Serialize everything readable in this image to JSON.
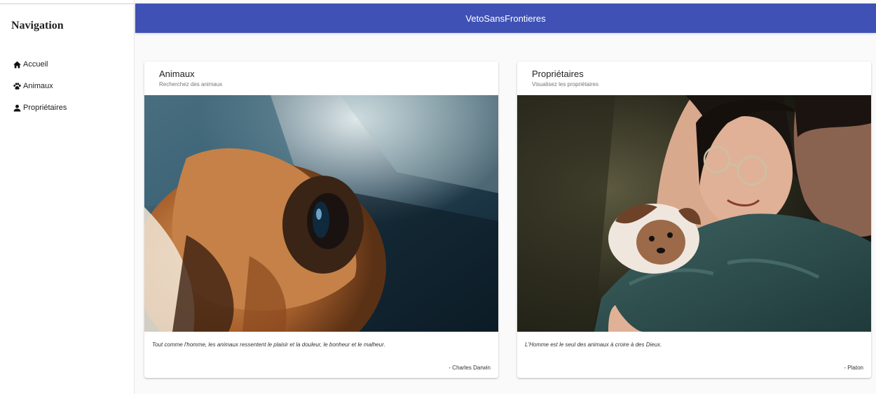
{
  "app": {
    "title": "VetoSansFrontieres"
  },
  "sidebar": {
    "heading": "Navigation",
    "items": [
      {
        "label": "Accueil",
        "icon": "home-icon"
      },
      {
        "label": "Animaux",
        "icon": "paw-icon"
      },
      {
        "label": "Propriétaires",
        "icon": "person-icon"
      }
    ]
  },
  "cards": [
    {
      "title": "Animaux",
      "subtitle": "Recherchez des animaux",
      "image": "dog-in-car-photo",
      "quote": "Tout comme l'homme, les animaux ressentent le plaisir et la douleur, le bonheur et le malheur.",
      "author": "- Charles Darwin"
    },
    {
      "title": "Propriétaires",
      "subtitle": "Visualisez les propriétaires",
      "image": "owners-with-dog-photo",
      "quote": "L'Homme est le seul des animaux à croire à des Dieux.",
      "author": "- Platon"
    }
  ],
  "colors": {
    "primary": "#3f51b5",
    "background": "#fafafa"
  }
}
